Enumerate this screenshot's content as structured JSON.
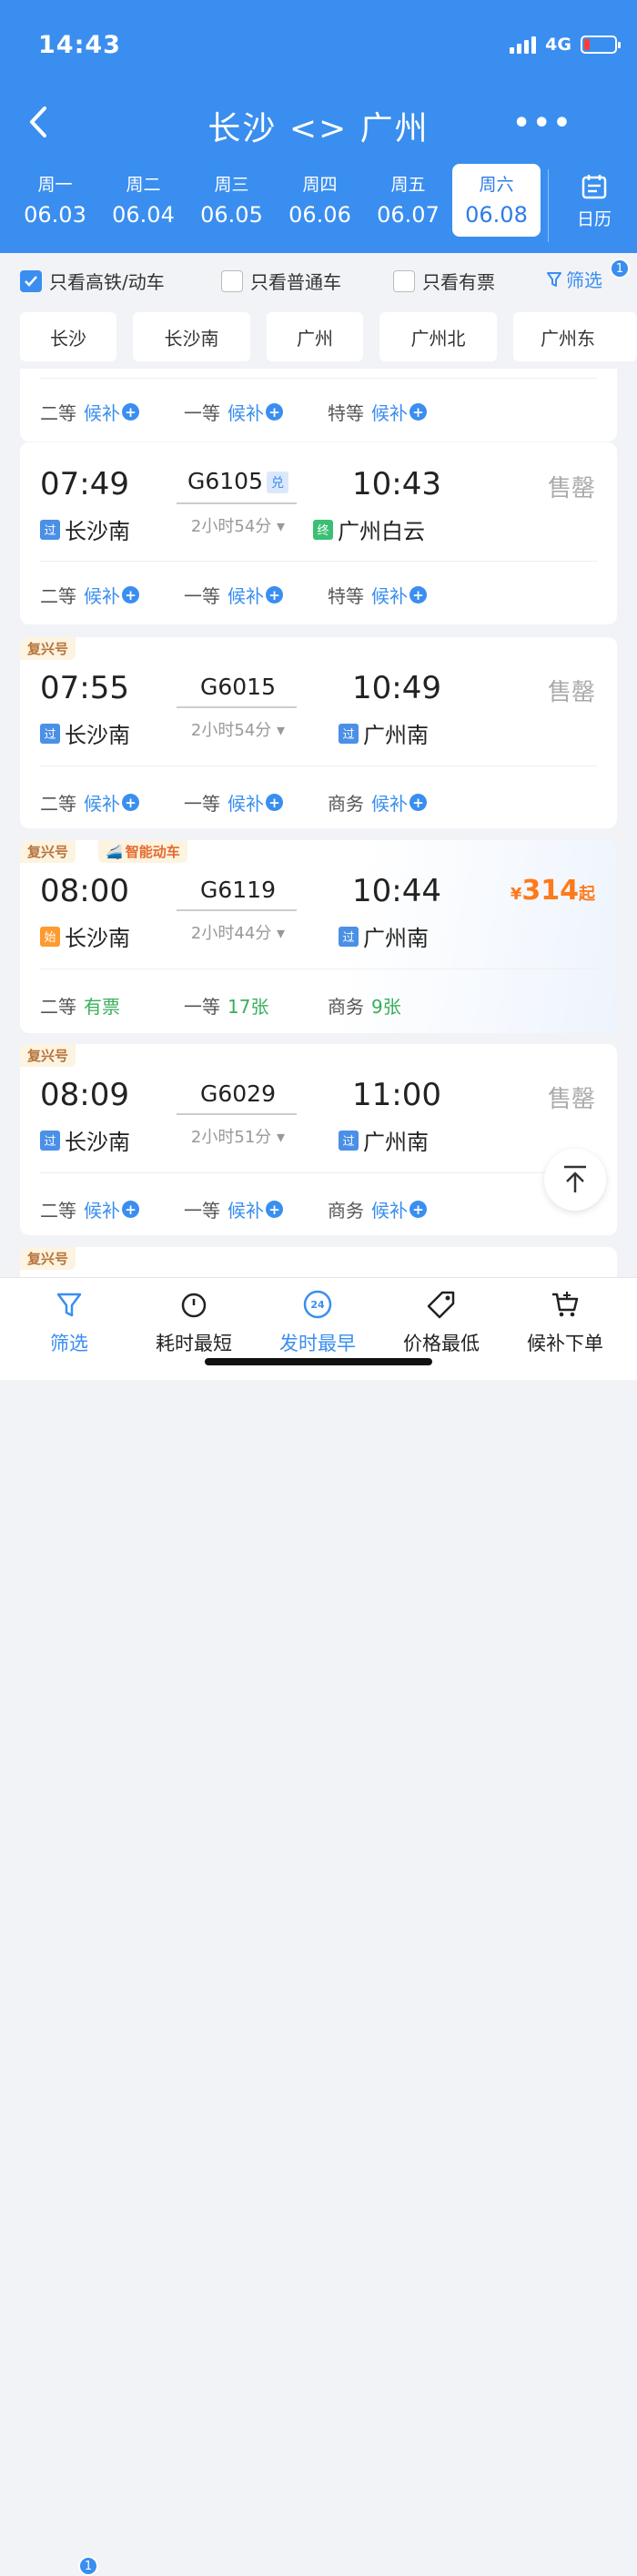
{
  "status": {
    "time": "14:43",
    "network": "4G"
  },
  "nav": {
    "title": "长沙 <> 广州",
    "more": "•••"
  },
  "dates": [
    {
      "weekday": "周一",
      "date": "06.03"
    },
    {
      "weekday": "周二",
      "date": "06.04"
    },
    {
      "weekday": "周三",
      "date": "06.05"
    },
    {
      "weekday": "周四",
      "date": "06.06"
    },
    {
      "weekday": "周五",
      "date": "06.07"
    },
    {
      "weekday": "周六",
      "date": "06.08",
      "selected": true
    }
  ],
  "calendar_label": "日历",
  "filters": {
    "high_speed": "只看高铁/动车",
    "normal": "只看普通车",
    "available": "只看有票",
    "filter_link": "筛选",
    "filter_count": "1",
    "high_speed_checked": true
  },
  "stations": [
    "长沙",
    "长沙南",
    "广州",
    "广州北",
    "广州东"
  ],
  "partial_card": {
    "seats": [
      {
        "class": "二等",
        "status": "候补"
      },
      {
        "class": "一等",
        "status": "候补"
      },
      {
        "class": "特等",
        "status": "候补"
      }
    ]
  },
  "trains": [
    {
      "dep": "07:49",
      "train": "G6105",
      "badge": "兑",
      "arr": "10:43",
      "duration": "2小时54分",
      "from_icon": "过",
      "from": "长沙南",
      "to_icon": "终",
      "to": "广州白云",
      "status": "售罄",
      "seats": [
        {
          "class": "二等",
          "status": "候补"
        },
        {
          "class": "一等",
          "status": "候补"
        },
        {
          "class": "特等",
          "status": "候补"
        }
      ]
    },
    {
      "tag": "复兴号",
      "dep": "07:55",
      "train": "G6015",
      "arr": "10:49",
      "duration": "2小时54分",
      "from_icon": "过",
      "from": "长沙南",
      "to_icon": "过",
      "to": "广州南",
      "status": "售罄",
      "seats": [
        {
          "class": "二等",
          "status": "候补"
        },
        {
          "class": "一等",
          "status": "候补"
        },
        {
          "class": "商务",
          "status": "候补"
        }
      ]
    },
    {
      "tag": "复兴号",
      "tag2": "智能动车",
      "dep": "08:00",
      "train": "G6119",
      "arr": "10:44",
      "duration": "2小时44分",
      "from_icon": "始",
      "from": "长沙南",
      "to_icon": "过",
      "to": "广州南",
      "price_symbol": "¥",
      "price": "314",
      "price_suffix": "起",
      "seats": [
        {
          "class": "二等",
          "status": "有票"
        },
        {
          "class": "一等",
          "status": "17张"
        },
        {
          "class": "商务",
          "status": "9张"
        }
      ]
    },
    {
      "tag": "复兴号",
      "dep": "08:09",
      "train": "G6029",
      "arr": "11:00",
      "duration": "2小时51分",
      "from_icon": "过",
      "from": "长沙南",
      "to_icon": "过",
      "to": "广州南",
      "status": "售罄",
      "seats": [
        {
          "class": "二等",
          "status": "候补"
        },
        {
          "class": "一等",
          "status": "候补"
        },
        {
          "class": "商务",
          "status": "候补"
        }
      ]
    }
  ],
  "next_card_tag": "复兴号",
  "tabbar": {
    "filter": "筛选",
    "filter_count": "1",
    "shortest": "耗时最短",
    "earliest": "发时最早",
    "earliest_icon_text": "24",
    "cheapest": "价格最低",
    "waitlist": "候补下单"
  }
}
